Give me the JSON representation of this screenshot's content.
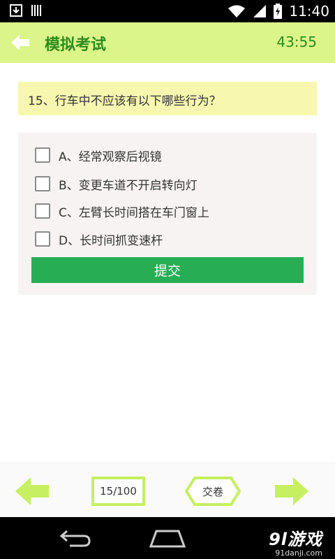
{
  "status_bar": {
    "time": "11:40",
    "icons": [
      "download-icon",
      "barcode-icon",
      "wifi-icon",
      "signal-icon",
      "battery-charging-icon"
    ]
  },
  "app_bar": {
    "title": "模拟考试",
    "timer": "43:55",
    "back_icon": "back-arrow-icon"
  },
  "question": {
    "text": "15、行车中不应该有以下哪些行为？"
  },
  "options": [
    {
      "label": "A、经常观察后视镜",
      "checked": false
    },
    {
      "label": "B、变更车道不开启转向灯",
      "checked": false
    },
    {
      "label": "C、左臂长时间搭在车门窗上",
      "checked": false
    },
    {
      "label": "D、长时间抓变速杆",
      "checked": false
    }
  ],
  "submit_button": {
    "label": "提交"
  },
  "bottom_toolbar": {
    "page_indicator": "15/100",
    "submit_paper_label": "交卷"
  },
  "colors": {
    "accent": "#dbf58a",
    "title_green": "#2f8a1c",
    "button_green": "#27ae55",
    "arrow_green": "#c6ef62",
    "question_bg": "#f7f7b0"
  },
  "watermark": {
    "main": "9l游戏",
    "sub": "91danji.com"
  }
}
